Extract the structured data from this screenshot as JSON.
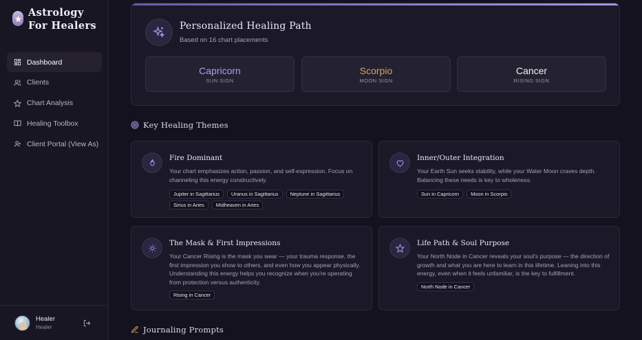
{
  "brand": {
    "title": "Astrology For Healers"
  },
  "nav": [
    {
      "label": "Dashboard",
      "icon": "dashboard-icon",
      "active": true
    },
    {
      "label": "Clients",
      "icon": "users-icon",
      "active": false
    },
    {
      "label": "Chart Analysis",
      "icon": "star-icon",
      "active": false
    },
    {
      "label": "Healing Toolbox",
      "icon": "book-icon",
      "active": false
    },
    {
      "label": "Client Portal (View As)",
      "icon": "user-icon",
      "active": false
    }
  ],
  "user": {
    "name": "Healer",
    "role": "Healer"
  },
  "healing_path": {
    "title": "Personalized Healing Path",
    "subtitle": "Based on 16 chart placements",
    "signs": [
      {
        "name": "Capricorn",
        "label": "SUN SIGN",
        "color": "#b49cf0"
      },
      {
        "name": "Scorpio",
        "label": "MOON SIGN",
        "color": "#d3a65a"
      },
      {
        "name": "Cancer",
        "label": "RISING SIGN",
        "color": "#f4f2f8"
      }
    ]
  },
  "themes_section": {
    "title": "Key Healing Themes"
  },
  "themes": [
    {
      "title": "Fire Dominant",
      "icon": "flame-icon",
      "description": "Your chart emphasizes action, passion, and self-expression. Focus on channeling this energy constructively.",
      "tags": [
        "Jupiter in Sagittarius",
        "Uranus in Sagittarius",
        "Neptune in Sagittarius",
        "Sirius in Aries",
        "Midheaven in Aries"
      ]
    },
    {
      "title": "Inner/Outer Integration",
      "icon": "heart-icon",
      "description": "Your Earth Sun seeks stability, while your Water Moon craves depth. Balancing these needs is key to wholeness.",
      "tags": [
        "Sun in Capricorn",
        "Moon in Scorpio"
      ]
    },
    {
      "title": "The Mask & First Impressions",
      "icon": "sun-icon",
      "description": "Your Cancer Rising is the mask you wear — your trauma response, the first impression you show to others, and even how you appear physically. Understanding this energy helps you recognize when you're operating from protection versus authenticity.",
      "tags": [
        "Rising in Cancer"
      ]
    },
    {
      "title": "Life Path & Soul Purpose",
      "icon": "star-icon",
      "description": "Your North Node in Cancer reveals your soul's purpose — the direction of growth and what you are here to learn in this lifetime. Leaning into this energy, even when it feels unfamiliar, is the key to fulfillment.",
      "tags": [
        "North Node in Cancer"
      ]
    }
  ],
  "journaling_section": {
    "title": "Journaling Prompts"
  }
}
